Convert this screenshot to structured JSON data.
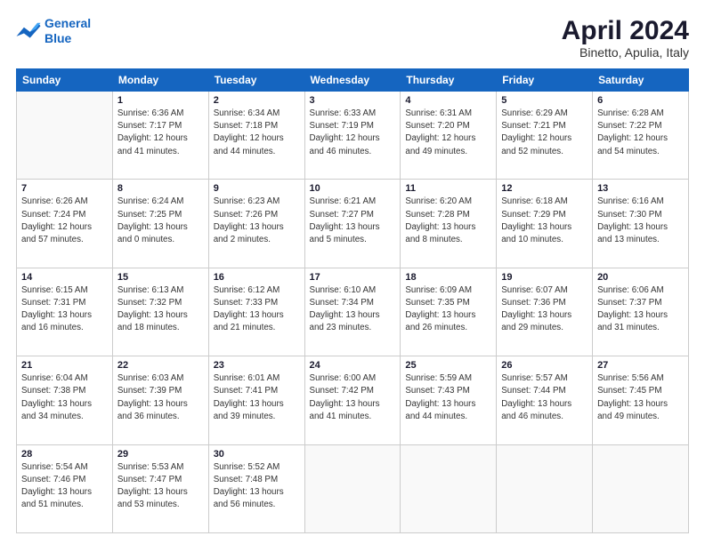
{
  "logo": {
    "line1": "General",
    "line2": "Blue"
  },
  "title": "April 2024",
  "subtitle": "Binetto, Apulia, Italy",
  "weekdays": [
    "Sunday",
    "Monday",
    "Tuesday",
    "Wednesday",
    "Thursday",
    "Friday",
    "Saturday"
  ],
  "weeks": [
    [
      {
        "day": "",
        "info": ""
      },
      {
        "day": "1",
        "info": "Sunrise: 6:36 AM\nSunset: 7:17 PM\nDaylight: 12 hours\nand 41 minutes."
      },
      {
        "day": "2",
        "info": "Sunrise: 6:34 AM\nSunset: 7:18 PM\nDaylight: 12 hours\nand 44 minutes."
      },
      {
        "day": "3",
        "info": "Sunrise: 6:33 AM\nSunset: 7:19 PM\nDaylight: 12 hours\nand 46 minutes."
      },
      {
        "day": "4",
        "info": "Sunrise: 6:31 AM\nSunset: 7:20 PM\nDaylight: 12 hours\nand 49 minutes."
      },
      {
        "day": "5",
        "info": "Sunrise: 6:29 AM\nSunset: 7:21 PM\nDaylight: 12 hours\nand 52 minutes."
      },
      {
        "day": "6",
        "info": "Sunrise: 6:28 AM\nSunset: 7:22 PM\nDaylight: 12 hours\nand 54 minutes."
      }
    ],
    [
      {
        "day": "7",
        "info": "Sunrise: 6:26 AM\nSunset: 7:24 PM\nDaylight: 12 hours\nand 57 minutes."
      },
      {
        "day": "8",
        "info": "Sunrise: 6:24 AM\nSunset: 7:25 PM\nDaylight: 13 hours\nand 0 minutes."
      },
      {
        "day": "9",
        "info": "Sunrise: 6:23 AM\nSunset: 7:26 PM\nDaylight: 13 hours\nand 2 minutes."
      },
      {
        "day": "10",
        "info": "Sunrise: 6:21 AM\nSunset: 7:27 PM\nDaylight: 13 hours\nand 5 minutes."
      },
      {
        "day": "11",
        "info": "Sunrise: 6:20 AM\nSunset: 7:28 PM\nDaylight: 13 hours\nand 8 minutes."
      },
      {
        "day": "12",
        "info": "Sunrise: 6:18 AM\nSunset: 7:29 PM\nDaylight: 13 hours\nand 10 minutes."
      },
      {
        "day": "13",
        "info": "Sunrise: 6:16 AM\nSunset: 7:30 PM\nDaylight: 13 hours\nand 13 minutes."
      }
    ],
    [
      {
        "day": "14",
        "info": "Sunrise: 6:15 AM\nSunset: 7:31 PM\nDaylight: 13 hours\nand 16 minutes."
      },
      {
        "day": "15",
        "info": "Sunrise: 6:13 AM\nSunset: 7:32 PM\nDaylight: 13 hours\nand 18 minutes."
      },
      {
        "day": "16",
        "info": "Sunrise: 6:12 AM\nSunset: 7:33 PM\nDaylight: 13 hours\nand 21 minutes."
      },
      {
        "day": "17",
        "info": "Sunrise: 6:10 AM\nSunset: 7:34 PM\nDaylight: 13 hours\nand 23 minutes."
      },
      {
        "day": "18",
        "info": "Sunrise: 6:09 AM\nSunset: 7:35 PM\nDaylight: 13 hours\nand 26 minutes."
      },
      {
        "day": "19",
        "info": "Sunrise: 6:07 AM\nSunset: 7:36 PM\nDaylight: 13 hours\nand 29 minutes."
      },
      {
        "day": "20",
        "info": "Sunrise: 6:06 AM\nSunset: 7:37 PM\nDaylight: 13 hours\nand 31 minutes."
      }
    ],
    [
      {
        "day": "21",
        "info": "Sunrise: 6:04 AM\nSunset: 7:38 PM\nDaylight: 13 hours\nand 34 minutes."
      },
      {
        "day": "22",
        "info": "Sunrise: 6:03 AM\nSunset: 7:39 PM\nDaylight: 13 hours\nand 36 minutes."
      },
      {
        "day": "23",
        "info": "Sunrise: 6:01 AM\nSunset: 7:41 PM\nDaylight: 13 hours\nand 39 minutes."
      },
      {
        "day": "24",
        "info": "Sunrise: 6:00 AM\nSunset: 7:42 PM\nDaylight: 13 hours\nand 41 minutes."
      },
      {
        "day": "25",
        "info": "Sunrise: 5:59 AM\nSunset: 7:43 PM\nDaylight: 13 hours\nand 44 minutes."
      },
      {
        "day": "26",
        "info": "Sunrise: 5:57 AM\nSunset: 7:44 PM\nDaylight: 13 hours\nand 46 minutes."
      },
      {
        "day": "27",
        "info": "Sunrise: 5:56 AM\nSunset: 7:45 PM\nDaylight: 13 hours\nand 49 minutes."
      }
    ],
    [
      {
        "day": "28",
        "info": "Sunrise: 5:54 AM\nSunset: 7:46 PM\nDaylight: 13 hours\nand 51 minutes."
      },
      {
        "day": "29",
        "info": "Sunrise: 5:53 AM\nSunset: 7:47 PM\nDaylight: 13 hours\nand 53 minutes."
      },
      {
        "day": "30",
        "info": "Sunrise: 5:52 AM\nSunset: 7:48 PM\nDaylight: 13 hours\nand 56 minutes."
      },
      {
        "day": "",
        "info": ""
      },
      {
        "day": "",
        "info": ""
      },
      {
        "day": "",
        "info": ""
      },
      {
        "day": "",
        "info": ""
      }
    ]
  ]
}
